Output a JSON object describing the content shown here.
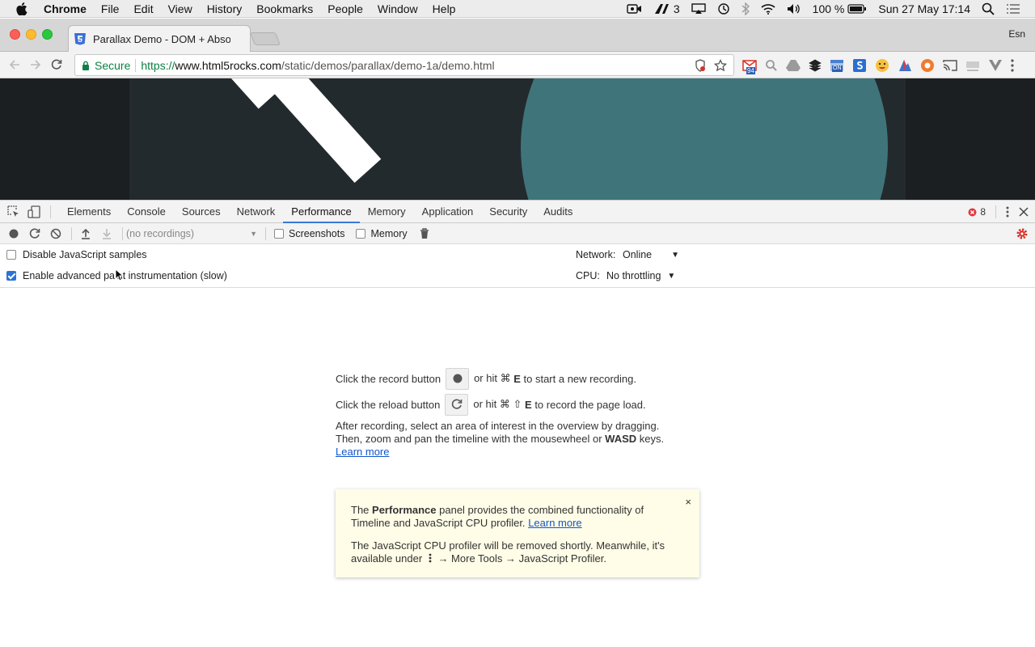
{
  "menubar": {
    "app_name": "Chrome",
    "items": [
      "File",
      "Edit",
      "View",
      "History",
      "Bookmarks",
      "People",
      "Window",
      "Help"
    ],
    "status": {
      "notification_count": "3",
      "battery": "100 %",
      "datetime": "Sun 27 May  17:14"
    }
  },
  "browser": {
    "tab_title": "Parallax Demo - DOM + Absolu",
    "profile_label": "Esn",
    "omnibox": {
      "secure_label": "Secure",
      "url_scheme": "https://",
      "url_host": "www.html5rocks.com",
      "url_path": "/static/demos/parallax/demo-1a/demo.html"
    },
    "extension_badge_94": "94",
    "extension_badge_on": "ON"
  },
  "devtools": {
    "tabs": [
      "Elements",
      "Console",
      "Sources",
      "Network",
      "Performance",
      "Memory",
      "Application",
      "Security",
      "Audits"
    ],
    "active_tab": "Performance",
    "error_count": "8",
    "toolbar": {
      "recordings_placeholder": "(no recordings)",
      "screenshots_label": "Screenshots",
      "memory_label": "Memory"
    },
    "settings": {
      "disable_js_samples_label": "Disable JavaScript samples",
      "disable_js_samples_checked": false,
      "advanced_paint_label": "Enable advanced paint instrumentation (slow)",
      "advanced_paint_checked": true,
      "network_label": "Network:",
      "network_value": "Online",
      "cpu_label": "CPU:",
      "cpu_value": "No throttling"
    },
    "landing": {
      "record_prefix": "Click the record button",
      "record_suffix_a": "or hit ⌘",
      "record_key": "E",
      "record_suffix_b": "to start a new recording.",
      "reload_prefix": "Click the reload button",
      "reload_suffix_a": "or hit ⌘ ⇧",
      "reload_key": "E",
      "reload_suffix_b": "to record the page load.",
      "para1": "After recording, select an area of interest in the overview by dragging.",
      "para2_a": "Then, zoom and pan the timeline with the mousewheel or",
      "para2_bold": "WASD",
      "para2_b": "keys.",
      "learn_more": "Learn more"
    },
    "infobox": {
      "line1_a": "The",
      "line1_bold": "Performance",
      "line1_b": "panel provides the combined functionality of",
      "line2": "Timeline and JavaScript CPU profiler.",
      "learn_more": "Learn more",
      "line3": "The JavaScript CPU profiler will be removed shortly. Meanwhile, it's",
      "line4_a": "available under",
      "line4_b": "→ More Tools → JavaScript Profiler.",
      "close": "×"
    }
  },
  "colors": {
    "accent_blue": "#3879d9",
    "secure_green": "#0b8043",
    "record_red": "#d93025",
    "info_bg": "#fffde7",
    "teal_circle": "#3f757a"
  }
}
